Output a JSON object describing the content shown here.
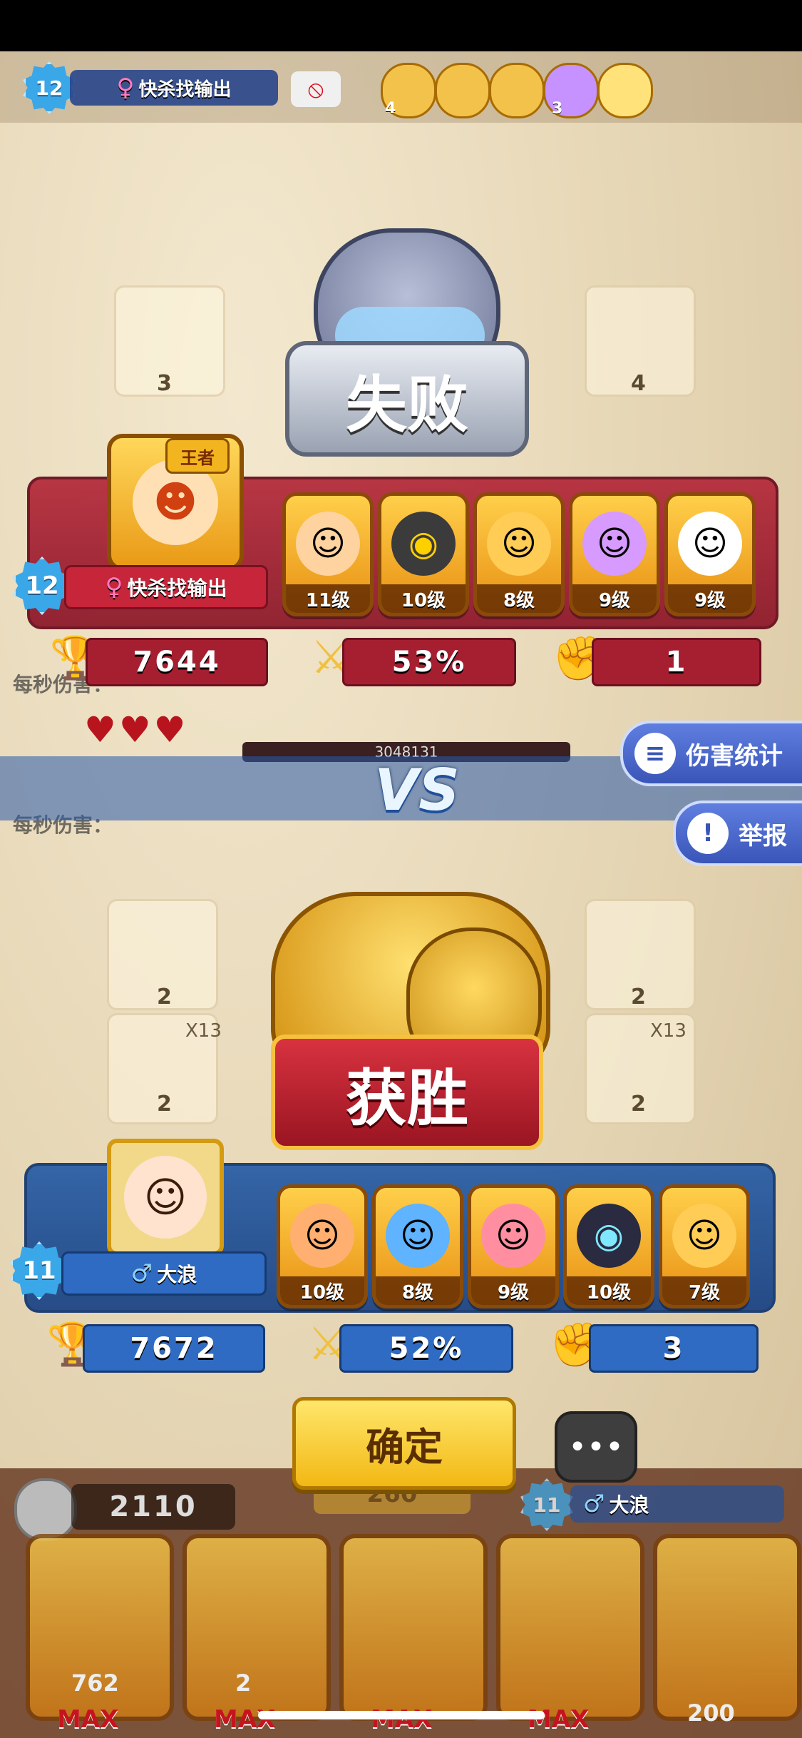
{
  "top_bar": {
    "level": "12",
    "name": "快杀找输出",
    "hero_stars": [
      "4",
      "3"
    ]
  },
  "loser": {
    "result_label": "失败",
    "level": "12",
    "name": "快杀找输出",
    "crown_label": "王者",
    "gender": "♀",
    "heroes": [
      {
        "level": "11级",
        "icon": "monkey-king-icon",
        "color": "#ffd3a0"
      },
      {
        "level": "10级",
        "icon": "hooded-mage-icon",
        "color": "#3b3b3b"
      },
      {
        "level": "8级",
        "icon": "mustache-chef-icon",
        "color": "#ffcc55"
      },
      {
        "level": "9级",
        "icon": "purple-witch-icon",
        "color": "#d79bff"
      },
      {
        "level": "9级",
        "icon": "white-ghost-icon",
        "color": "#ffffff"
      }
    ],
    "trophies": "7644",
    "win_rate": "53%",
    "streak": "1"
  },
  "vs_label": "VS",
  "boss_hp": "3048131",
  "bg_text": {
    "dps_top": "每秒伤害：",
    "dps_bottom": "每秒伤害：",
    "cell_counts": [
      "3",
      "4",
      "2",
      "2",
      "2",
      "2",
      "X13",
      "X13"
    ]
  },
  "side_buttons": {
    "damage_stats": "伤害统计",
    "report": "举报"
  },
  "winner": {
    "result_label": "获胜",
    "level": "11",
    "name": "大浪",
    "gender": "♂",
    "heroes": [
      {
        "level": "10级",
        "icon": "monkey-king-icon",
        "color": "#ffb070"
      },
      {
        "level": "8级",
        "icon": "pharaoh-icon",
        "color": "#5fb3ff"
      },
      {
        "level": "9级",
        "icon": "monocle-pig-icon",
        "color": "#ff8fa0"
      },
      {
        "level": "10级",
        "icon": "masked-anubis-icon",
        "color": "#2a2a40"
      },
      {
        "level": "7级",
        "icon": "mustache-chef-icon",
        "color": "#ffcc55"
      }
    ],
    "trophies": "7672",
    "win_rate": "52%",
    "streak": "3"
  },
  "confirm_label": "确定",
  "bottom_bar": {
    "coins": "2110",
    "mid_value": "260",
    "player_level": "11",
    "player_name": "大浪",
    "card_values": [
      "762",
      "2"
    ],
    "max_label": "MAX",
    "right_value": "200"
  }
}
